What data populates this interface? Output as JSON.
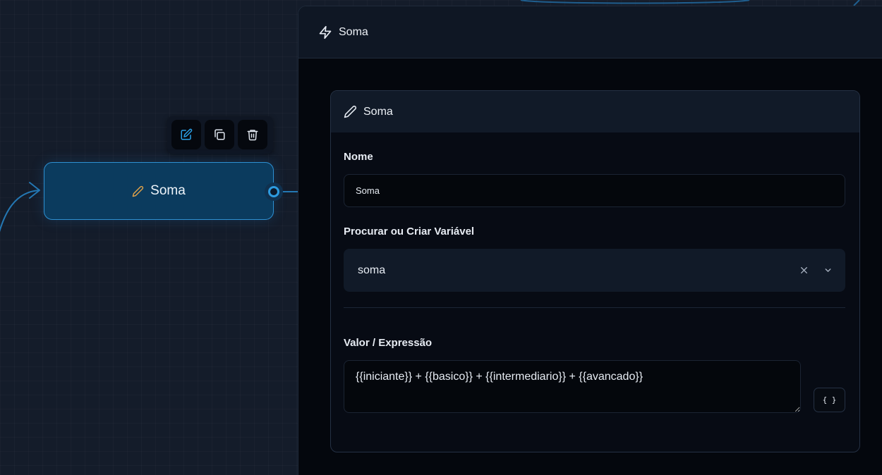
{
  "canvas": {
    "node": {
      "label": "Soma",
      "icon": "pencil-icon"
    },
    "toolbar": {
      "edit_icon": "edit-icon",
      "copy_icon": "copy-icon",
      "delete_icon": "trash-icon"
    }
  },
  "panel": {
    "title": "Soma",
    "title_icon": "lightning-icon",
    "card": {
      "title": "Soma",
      "title_icon": "pencil-icon",
      "name_label": "Nome",
      "name_value": "Soma",
      "variable_label": "Procurar ou Criar Variável",
      "variable_value": "soma",
      "value_label": "Valor / Expressão",
      "value_expression": "{{iniciante}} + {{basico}} + {{intermediario}} + {{avancado}}",
      "expression_button": "{ }"
    }
  },
  "colors": {
    "accent": "#2d9be0",
    "node_bg": "#0b3b5e",
    "pencil": "#e0a24a",
    "panel_bg": "#04070d"
  }
}
